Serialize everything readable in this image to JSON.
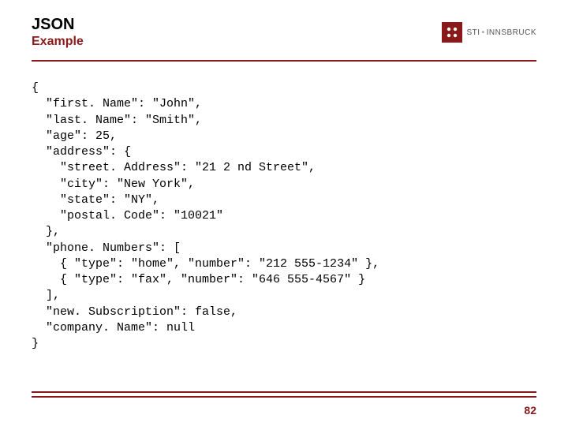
{
  "header": {
    "title": "JSON",
    "subtitle": "Example",
    "logo_text_a": "STI",
    "logo_text_b": "INNSBRUCK"
  },
  "code": "{\n  \"first. Name\": \"John\",\n  \"last. Name\": \"Smith\",\n  \"age\": 25,\n  \"address\": {\n    \"street. Address\": \"21 2 nd Street\",\n    \"city\": \"New York\",\n    \"state\": \"NY\",\n    \"postal. Code\": \"10021\"\n  },\n  \"phone. Numbers\": [\n    { \"type\": \"home\", \"number\": \"212 555-1234\" },\n    { \"type\": \"fax\", \"number\": \"646 555-4567\" }\n  ],\n  \"new. Subscription\": false,\n  \"company. Name\": null\n}",
  "page_number": "82"
}
